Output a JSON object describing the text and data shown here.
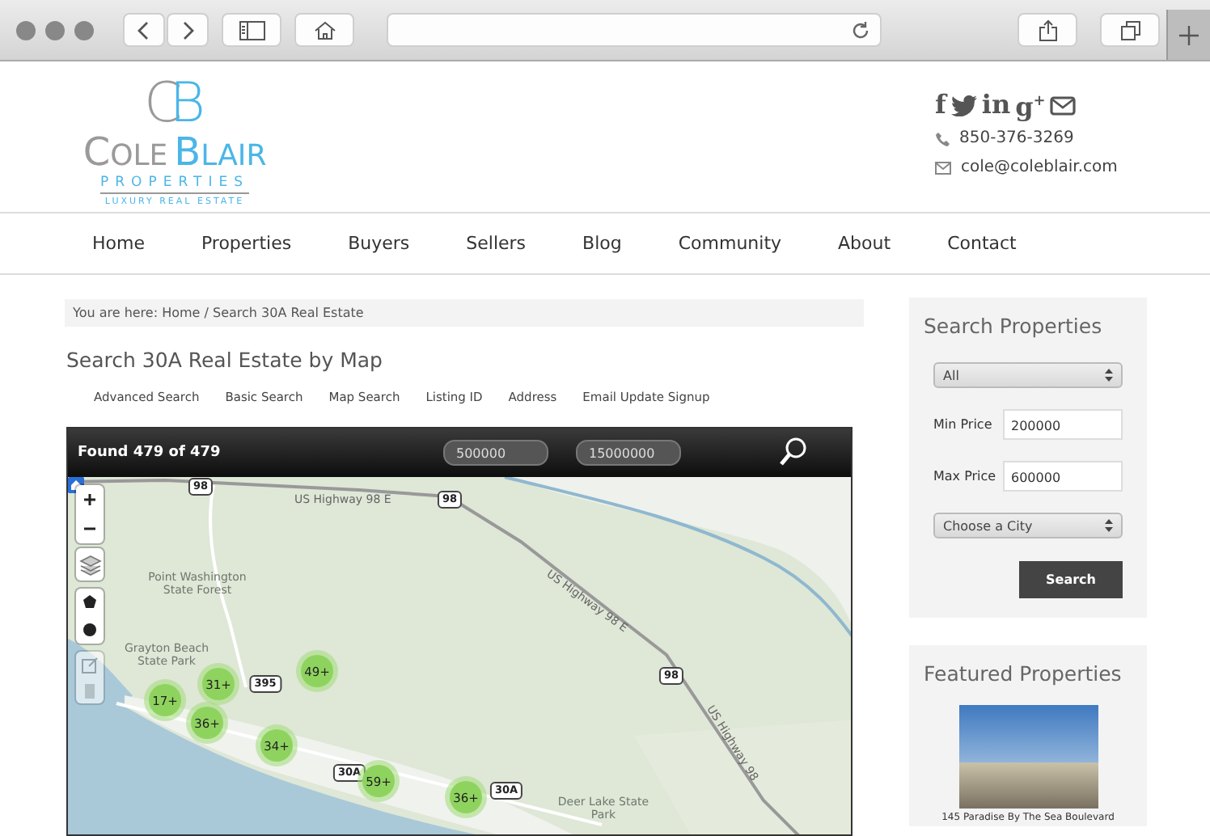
{
  "logo": {
    "monogram_left": "C",
    "monogram_right": "B",
    "name_left": "COLE",
    "name_right": "BLAIR",
    "tagline": "PROPERTIES",
    "subtag": "LUXURY REAL ESTATE"
  },
  "social": [
    {
      "kind": "text",
      "label": "f"
    },
    {
      "kind": "bird"
    },
    {
      "kind": "text",
      "label": "in"
    },
    {
      "kind": "text",
      "label": "g$^{+}$"
    },
    {
      "kind": "mail"
    }
  ],
  "contact": [
    {
      "kind": "phone",
      "text": "850-376-3269"
    },
    {
      "kind": "mail",
      "text": "cole@coleblair.com"
    }
  ],
  "nav": [
    "Home",
    "Properties",
    "Buyers",
    "Sellers",
    "Blog",
    "Community",
    "About",
    "Contact"
  ],
  "breadcrumb": "You are here: Home / Search 30A Real Estate",
  "page_title": "Search 30A Real Estate by Map",
  "search_tabs": [
    "Advanced Search",
    "Basic Search",
    "Map Search",
    "Listing ID",
    "Address",
    "Email Update Signup"
  ],
  "map": {
    "found": "Found 479 of 479",
    "min_price": "500000",
    "max_price": "15000000",
    "labels": [
      {
        "kind": "road",
        "text": "US Highway 98 E"
      },
      {
        "kind": "road",
        "text": "US Highway 98 E"
      },
      {
        "kind": "road",
        "text": "US Highway 98"
      },
      {
        "kind": "park",
        "text": "Point Washington State Forest"
      },
      {
        "kind": "park",
        "text": "Grayton Beach State Park"
      },
      {
        "kind": "park",
        "text": "Deer Lake State Park"
      }
    ],
    "shields": [
      "98",
      "98",
      "98",
      "395",
      "30A",
      "30A"
    ],
    "clusters": [
      "49+",
      "31+",
      "17+",
      "36+",
      "34+",
      "59+",
      "36+"
    ]
  },
  "sidebar": {
    "title": "Search Properties",
    "type_select": "All",
    "fields": [
      {
        "label": "Min Price",
        "value": "200000"
      },
      {
        "label": "Max Price",
        "value": "600000"
      }
    ],
    "city_select": "Choose a City",
    "button": "Search"
  },
  "featured": {
    "title": "Featured Properties",
    "caption": "145 Paradise By The Sea Boulevard"
  }
}
